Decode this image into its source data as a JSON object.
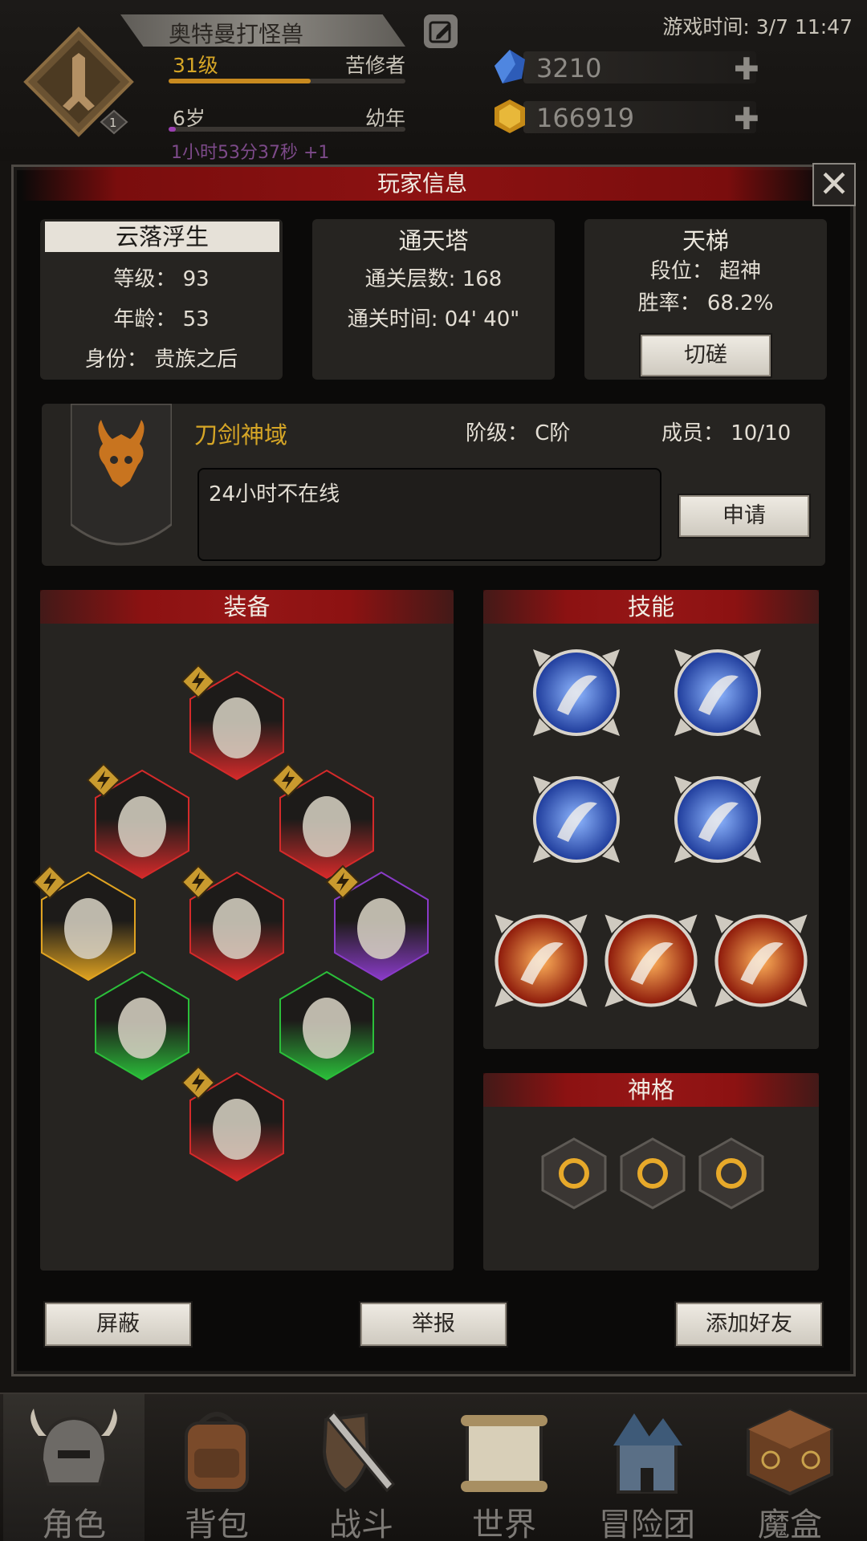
{
  "header": {
    "player_name": "奥特曼打怪兽",
    "level": "31级",
    "title": "苦修者",
    "age": "6岁",
    "age_stage": "幼年",
    "timer": "1小时53分37秒 +1",
    "game_time": "游戏时间: 3/7 11:47",
    "emblem_badge": "1",
    "currency": [
      {
        "name": "blue-crystal",
        "amount": "3210",
        "icon": "blue-crystal-icon",
        "color": "#3b6fd1"
      },
      {
        "name": "gold-crystal",
        "amount": "166919",
        "icon": "gold-crystal-icon",
        "color": "#d6a626"
      }
    ],
    "level_progress": 0.6,
    "age_progress": 0.03
  },
  "panel": {
    "title": "玩家信息",
    "close": "✕"
  },
  "profile": {
    "name": "云落浮生",
    "level_line": "等级： 93",
    "age_line": "年龄： 53",
    "identity_line": "身份： 贵族之后"
  },
  "tower": {
    "title": "通天塔",
    "floors_line": "通关层数: 168",
    "time_line": "通关时间: 04' 40\""
  },
  "ladder": {
    "title": "天梯",
    "rank_line": "段位： 超神",
    "winrate_line": "胜率： 68.2%",
    "spar_button": "切磋"
  },
  "guild": {
    "name": "刀剑神域",
    "rank_line": "阶级： C阶",
    "members_line": "成员： 10/10",
    "notice": "24小时不在线",
    "apply_button": "申请"
  },
  "equipment": {
    "title": "装备",
    "slots": [
      {
        "name": "helmet",
        "rarity": "red"
      },
      {
        "name": "armor-shoulder",
        "rarity": "red"
      },
      {
        "name": "amulet",
        "rarity": "red"
      },
      {
        "name": "belt",
        "rarity": "gold"
      },
      {
        "name": "chest",
        "rarity": "red"
      },
      {
        "name": "cloak",
        "rarity": "purple"
      },
      {
        "name": "weapon-left",
        "rarity": "green"
      },
      {
        "name": "weapon-right",
        "rarity": "green"
      },
      {
        "name": "boots",
        "rarity": "red"
      }
    ]
  },
  "skills": {
    "title": "技能",
    "items": [
      {
        "name": "frost-slash",
        "element": "ice"
      },
      {
        "name": "shadow-cloak",
        "element": "ice"
      },
      {
        "name": "frost-orbs",
        "element": "ice"
      },
      {
        "name": "twin-spirits",
        "element": "ice"
      },
      {
        "name": "flame-crescent",
        "element": "fire"
      },
      {
        "name": "flame-claw",
        "element": "fire"
      },
      {
        "name": "flame-avatar",
        "element": "fire"
      }
    ]
  },
  "divinity": {
    "title": "神格",
    "items": [
      "moon-rune",
      "peak-rune",
      "hourglass-rune"
    ]
  },
  "actions": {
    "block": "屏蔽",
    "report": "举报",
    "add_friend": "添加好友"
  },
  "nav": [
    {
      "label": "角色",
      "icon": "helmet-icon",
      "active": true
    },
    {
      "label": "背包",
      "icon": "backpack-icon",
      "active": false
    },
    {
      "label": "战斗",
      "icon": "sword-shield-icon",
      "active": false
    },
    {
      "label": "世界",
      "icon": "scroll-map-icon",
      "active": false
    },
    {
      "label": "冒险团",
      "icon": "castle-icon",
      "active": false
    },
    {
      "label": "魔盒",
      "icon": "magic-box-icon",
      "active": false
    }
  ]
}
